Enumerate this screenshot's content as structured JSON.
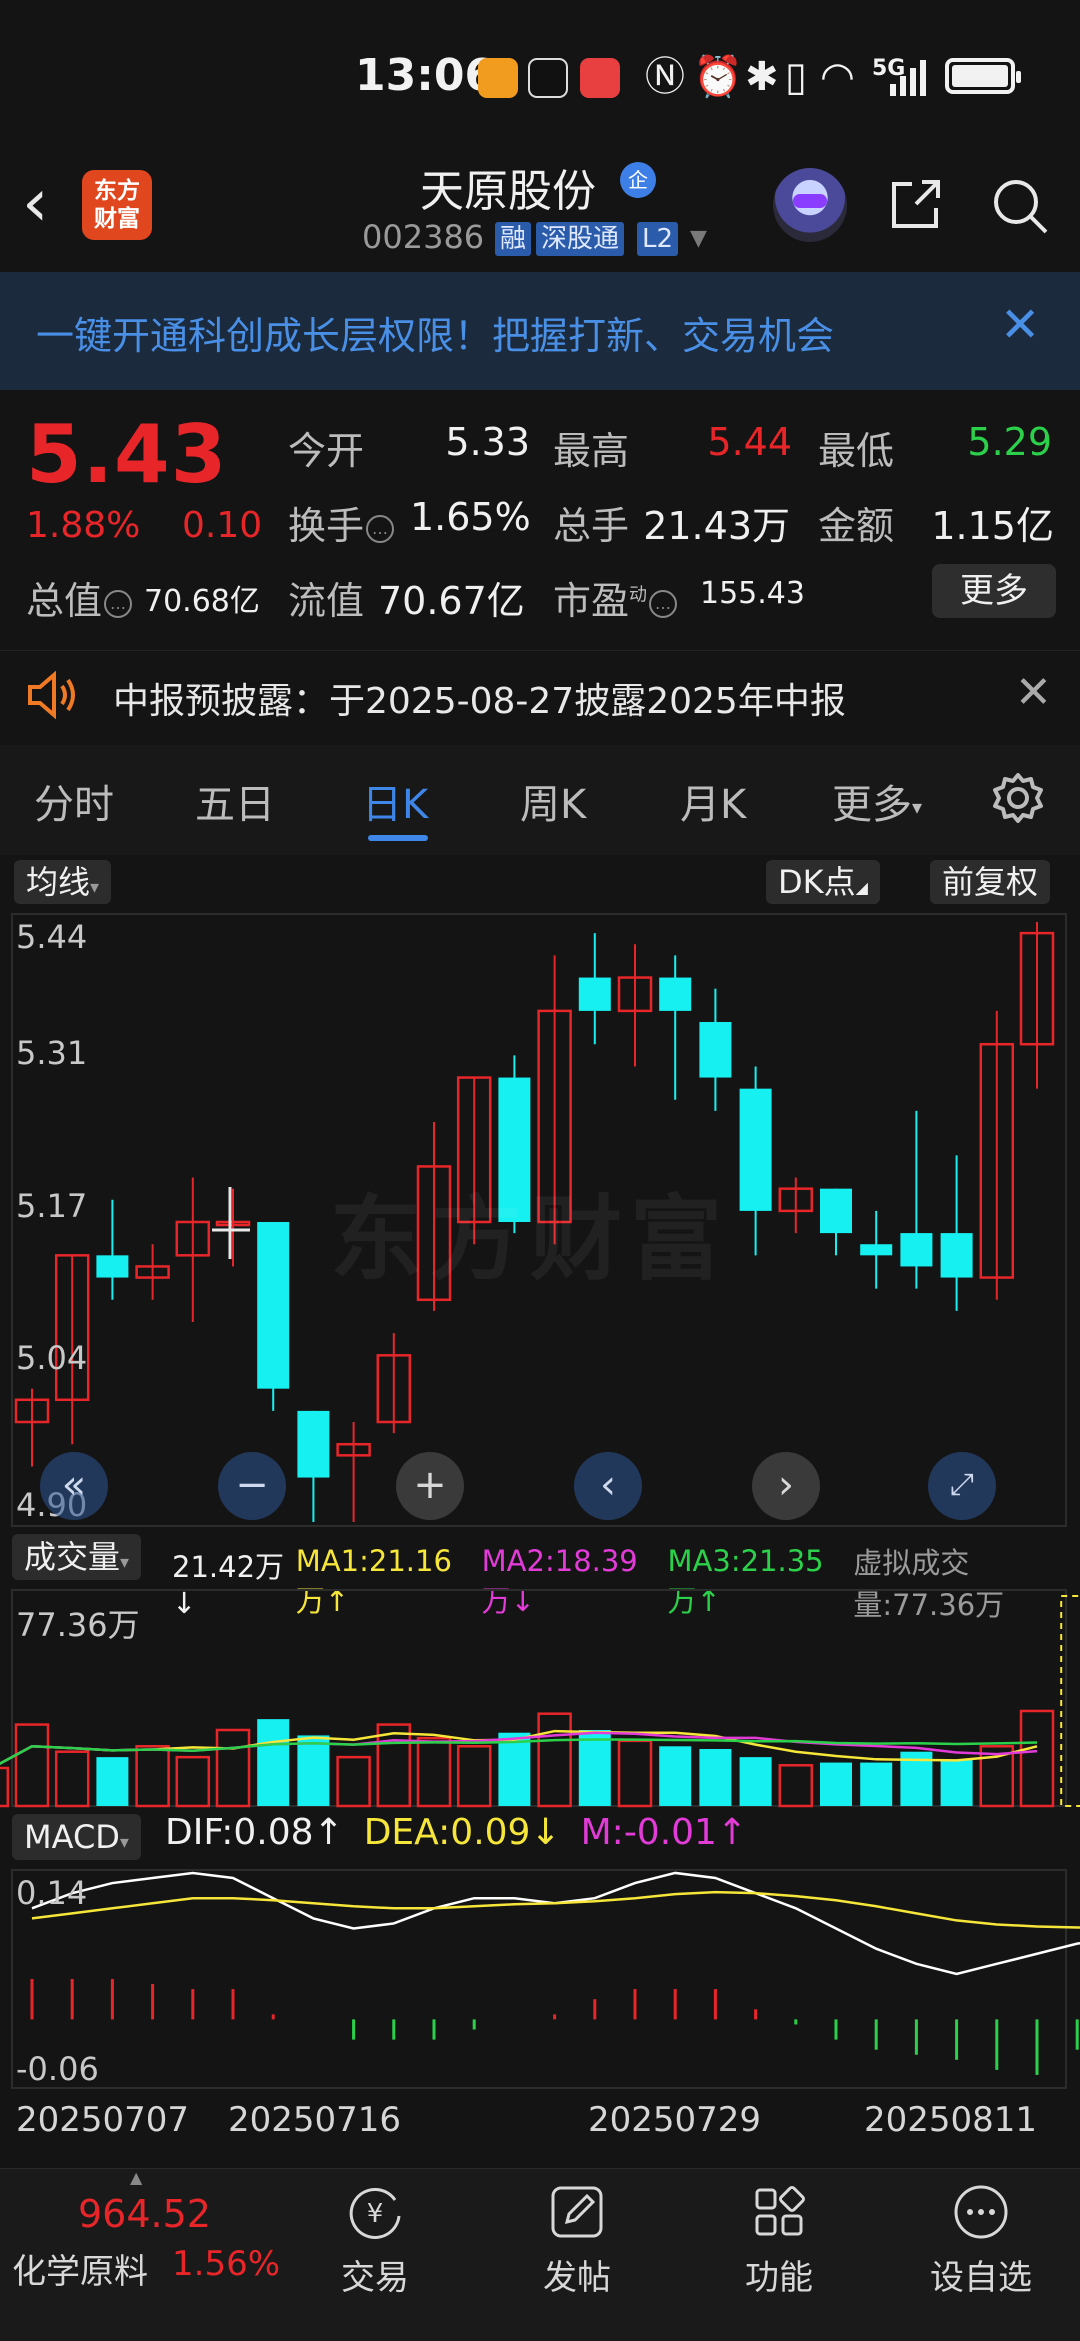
{
  "status_bar": {
    "time": "13:06",
    "app_icons": [
      "taobao-icon",
      "tiktok-icon",
      "huawei-icon"
    ],
    "status_icons": [
      "nfc-icon",
      "alarm-icon",
      "bluetooth-icon",
      "vibrate-icon",
      "wifi-icon",
      "5g-signal-icon",
      "battery-charging-icon"
    ],
    "network": "5G"
  },
  "header": {
    "logo_text": "东方\n财富",
    "title": "天原股份",
    "enterprise_badge": "企",
    "code": "002386",
    "tags": [
      "融",
      "深股通",
      "L2"
    ]
  },
  "banner": {
    "text": "一键开通科创成长层权限！把握打新、交易机会"
  },
  "quote": {
    "price": "5.43",
    "change_pct": "1.88%",
    "change": "0.10",
    "open_label": "今开",
    "open": "5.33",
    "high_label": "最高",
    "high": "5.44",
    "low_label": "最低",
    "low": "5.29",
    "turnover_label": "换手",
    "turnover": "1.65%",
    "volume_label": "总手",
    "volume": "21.43万",
    "amount_label": "金额",
    "amount": "1.15亿",
    "mktcap_label": "总值",
    "mktcap": "70.68亿",
    "float_label": "流值",
    "float": "70.67亿",
    "pe_label": "市盈",
    "pe_sup": "动",
    "pe": "155.43",
    "more": "更多"
  },
  "notice": {
    "text": "中报预披露：于2025-08-27披露2025年中报"
  },
  "tabs": {
    "items": [
      "分时",
      "五日",
      "日K",
      "周K",
      "月K",
      "更多"
    ],
    "active": "日K"
  },
  "chart_controls": {
    "ma_selector": "均线",
    "dk_point": "DK点",
    "adjust": "前复权"
  },
  "chart_data": {
    "type": "candlestick",
    "y_ticks": [
      "5.44",
      "5.31",
      "5.17",
      "5.04",
      "4.90"
    ],
    "ylim": [
      4.9,
      5.44
    ],
    "x_ticks": [
      "20250707",
      "20250716",
      "20250729",
      "20250811"
    ],
    "candles": [
      {
        "o": 4.99,
        "h": 5.02,
        "l": 4.95,
        "c": 5.01
      },
      {
        "o": 5.01,
        "h": 5.14,
        "l": 4.97,
        "c": 5.14
      },
      {
        "o": 5.14,
        "h": 5.19,
        "l": 5.1,
        "c": 5.12
      },
      {
        "o": 5.12,
        "h": 5.15,
        "l": 5.1,
        "c": 5.13
      },
      {
        "o": 5.14,
        "h": 5.21,
        "l": 5.08,
        "c": 5.17
      },
      {
        "o": 5.17,
        "h": 5.2,
        "l": 5.13,
        "c": 5.17
      },
      {
        "o": 5.17,
        "h": 5.17,
        "l": 5.0,
        "c": 5.02
      },
      {
        "o": 5.0,
        "h": 4.99,
        "l": 4.9,
        "c": 4.94
      },
      {
        "o": 4.96,
        "h": 4.99,
        "l": 4.9,
        "c": 4.97
      },
      {
        "o": 4.99,
        "h": 5.07,
        "l": 4.98,
        "c": 5.05
      },
      {
        "o": 5.1,
        "h": 5.26,
        "l": 5.09,
        "c": 5.22
      },
      {
        "o": 5.17,
        "h": 5.3,
        "l": 5.15,
        "c": 5.3
      },
      {
        "o": 5.3,
        "h": 5.32,
        "l": 5.16,
        "c": 5.17
      },
      {
        "o": 5.17,
        "h": 5.41,
        "l": 5.15,
        "c": 5.36
      },
      {
        "o": 5.39,
        "h": 5.43,
        "l": 5.33,
        "c": 5.36
      },
      {
        "o": 5.36,
        "h": 5.42,
        "l": 5.31,
        "c": 5.39
      },
      {
        "o": 5.39,
        "h": 5.41,
        "l": 5.28,
        "c": 5.36
      },
      {
        "o": 5.35,
        "h": 5.38,
        "l": 5.27,
        "c": 5.3
      },
      {
        "o": 5.29,
        "h": 5.31,
        "l": 5.14,
        "c": 5.18
      },
      {
        "o": 5.18,
        "h": 5.21,
        "l": 5.16,
        "c": 5.2
      },
      {
        "o": 5.2,
        "h": 5.2,
        "l": 5.14,
        "c": 5.16
      },
      {
        "o": 5.15,
        "h": 5.18,
        "l": 5.11,
        "c": 5.14
      },
      {
        "o": 5.16,
        "h": 5.27,
        "l": 5.11,
        "c": 5.13
      },
      {
        "o": 5.16,
        "h": 5.23,
        "l": 5.09,
        "c": 5.12
      },
      {
        "o": 5.12,
        "h": 5.36,
        "l": 5.1,
        "c": 5.33
      },
      {
        "o": 5.33,
        "h": 5.44,
        "l": 5.29,
        "c": 5.43
      }
    ]
  },
  "chart_nav": [
    "fast-back-icon",
    "zoom-out-icon",
    "zoom-in-icon",
    "prev-icon",
    "next-icon",
    "fullscreen-icon"
  ],
  "volume_panel": {
    "label": "成交量",
    "current": "21.42万↓",
    "ma1": "MA1:21.16万↑",
    "ma2": "MA2:18.39万↓",
    "ma3": "MA3:21.35万↑",
    "virtual": "虚拟成交量:77.36万",
    "max_label": "77.36万",
    "colors": {
      "ma1": "#f7e63a",
      "ma2": "#e23bd8",
      "ma3": "#2bd14a"
    },
    "bars": [
      14,
      30,
      20,
      18,
      22,
      18,
      28,
      32,
      26,
      18,
      30,
      25,
      22,
      27,
      34,
      28,
      24,
      22,
      21,
      18,
      15,
      16,
      16,
      20,
      17,
      22,
      35,
      77.36
    ]
  },
  "macd_panel": {
    "label": "MACD",
    "dif": "DIF:0.08↑",
    "dea": "DEA:0.09↓",
    "m": "M:-0.01↑",
    "ylim_labels": [
      "0.14",
      "-0.06"
    ],
    "colors": {
      "dif": "#ffffff",
      "dea": "#f7e63a",
      "m": "#e23bd8"
    },
    "hist": [
      0.04,
      0.04,
      0.04,
      0.035,
      0.03,
      0.03,
      0.005,
      0.0,
      -0.02,
      -0.02,
      -0.02,
      -0.01,
      0.0,
      0.005,
      0.02,
      0.03,
      0.03,
      0.03,
      0.01,
      -0.005,
      -0.02,
      -0.03,
      -0.035,
      -0.04,
      -0.05,
      -0.055,
      -0.03,
      -0.01
    ]
  },
  "bottom_bar": {
    "index_value": "964.52",
    "index_name": "化学原料",
    "index_pct": "1.56%",
    "items": [
      {
        "label": "交易",
        "icon": "trade-icon"
      },
      {
        "label": "发帖",
        "icon": "post-icon"
      },
      {
        "label": "功能",
        "icon": "function-icon"
      },
      {
        "label": "设自选",
        "icon": "add-watchlist-icon"
      }
    ]
  }
}
